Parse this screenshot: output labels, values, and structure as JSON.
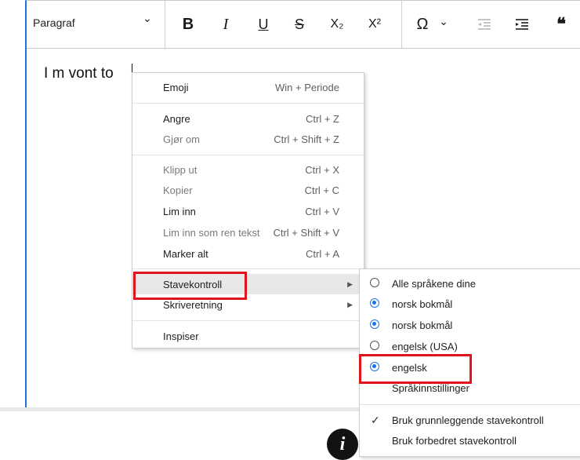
{
  "toolbar": {
    "paragraph_label": "Paragraf",
    "chevron": "⌄",
    "bold": "B",
    "italic": "I",
    "underline": "U",
    "strike": "S",
    "subscript": "X₂",
    "superscript": "X²",
    "omega": "Ω",
    "omega_chevron": "⌄",
    "quote": "❝"
  },
  "editor": {
    "text": "I m vont to"
  },
  "context_menu": {
    "emoji": {
      "label": "Emoji",
      "shortcut": "Win + Periode"
    },
    "undo": {
      "label": "Angre",
      "shortcut": "Ctrl + Z"
    },
    "redo": {
      "label": "Gjør om",
      "shortcut": "Ctrl + Shift + Z"
    },
    "cut": {
      "label": "Klipp ut",
      "shortcut": "Ctrl + X"
    },
    "copy": {
      "label": "Kopier",
      "shortcut": "Ctrl + C"
    },
    "paste": {
      "label": "Lim inn",
      "shortcut": "Ctrl + V"
    },
    "paste_plain": {
      "label": "Lim inn som ren tekst",
      "shortcut": "Ctrl + Shift + V"
    },
    "select_all": {
      "label": "Marker alt",
      "shortcut": "Ctrl + A"
    },
    "spellcheck": {
      "label": "Stavekontroll"
    },
    "writing_direction": {
      "label": "Skriveretning"
    },
    "inspect": {
      "label": "Inspiser"
    }
  },
  "spellcheck_submenu": {
    "all_languages": "Alle språkene dine",
    "norsk_bokmal_1": "norsk bokmål",
    "norsk_bokmal_2": "norsk bokmål",
    "english_usa": "engelsk (USA)",
    "english": "engelsk",
    "language_settings": "Språkinnstillinger",
    "basic_spellcheck": "Bruk grunnleggende stavekontroll",
    "enhanced_spellcheck": "Bruk forbedret stavekontroll",
    "checkmark": "✓"
  },
  "info_badge": "i",
  "colors": {
    "accent": "#1a73e8",
    "highlight_box": "#e0141c",
    "focus_border": "#1e73d6"
  }
}
